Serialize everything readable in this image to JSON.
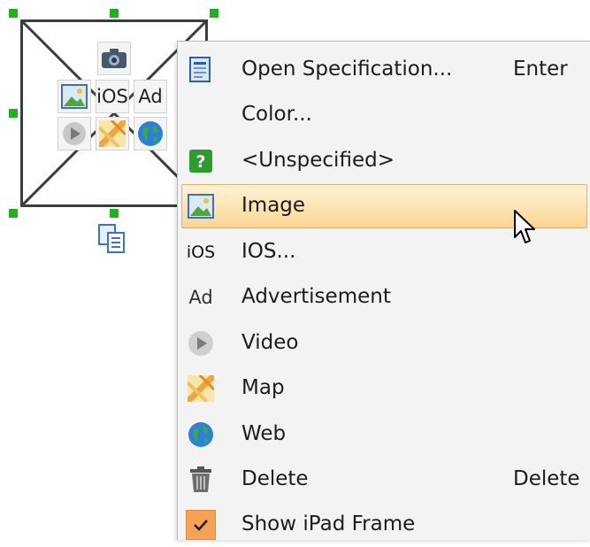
{
  "placeholder": {
    "tiles": {
      "ios": "iOS",
      "ad": "Ad"
    }
  },
  "menu": {
    "items": [
      {
        "label": "Open Specification...",
        "shortcut": "Enter",
        "icon": "specification-icon"
      },
      {
        "label": "Color...",
        "shortcut": "",
        "icon": ""
      },
      {
        "label": "<Unspecified>",
        "shortcut": "",
        "icon": "question-icon"
      },
      {
        "label": "Image",
        "shortcut": "",
        "icon": "image-icon",
        "highlighted": true
      },
      {
        "label": "IOS...",
        "shortcut": "",
        "icon": "ios-icon",
        "icon_text": "iOS"
      },
      {
        "label": "Advertisement",
        "shortcut": "",
        "icon": "ad-icon",
        "icon_text": "Ad"
      },
      {
        "label": "Video",
        "shortcut": "",
        "icon": "video-play-icon"
      },
      {
        "label": "Map",
        "shortcut": "",
        "icon": "map-icon"
      },
      {
        "label": "Web",
        "shortcut": "",
        "icon": "globe-icon"
      },
      {
        "label": "Delete",
        "shortcut": "Delete",
        "icon": "trash-icon"
      },
      {
        "label": "Show iPad Frame",
        "shortcut": "",
        "icon": "checkmark-icon",
        "checked": true
      }
    ]
  },
  "colors": {
    "selection_handle": "#22b022",
    "highlight_top": "#fff3d8",
    "highlight_bottom": "#fbd592",
    "menu_background": "#f3f3f3",
    "check_background": "#f5a256"
  }
}
